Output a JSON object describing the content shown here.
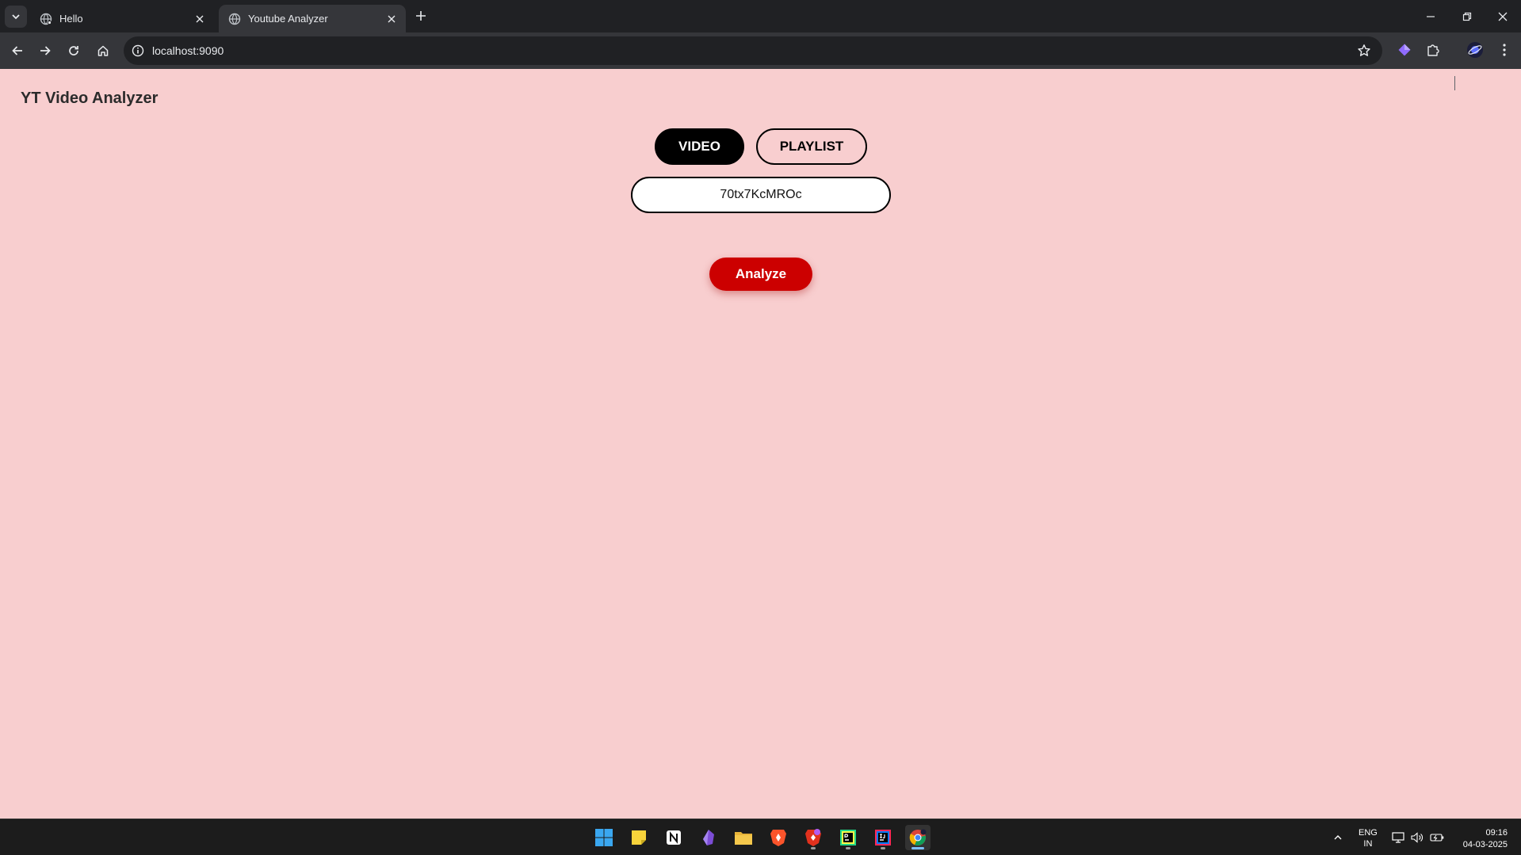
{
  "browser": {
    "tabs": [
      {
        "title": "Hello",
        "active": false
      },
      {
        "title": "Youtube Analyzer",
        "active": true
      }
    ],
    "url": "localhost:9090"
  },
  "page": {
    "title": "YT Video Analyzer",
    "toggle": {
      "video_label": "VIDEO",
      "playlist_label": "PLAYLIST",
      "selected": "VIDEO"
    },
    "video_id_value": "70tx7KcMROc",
    "analyze_label": "Analyze"
  },
  "taskbar": {
    "apps": [
      "windows-start",
      "sticky-notes",
      "notion",
      "obsidian",
      "file-explorer",
      "brave",
      "brave-nightly",
      "pycharm",
      "intellij-idea",
      "chrome"
    ],
    "language": "ENG",
    "region": "IN",
    "time": "09:16",
    "date": "04-03-2025"
  },
  "colors": {
    "page_background": "#f8cecf",
    "analyze_button": "#cc0000",
    "toggle_selected": "#000000"
  }
}
